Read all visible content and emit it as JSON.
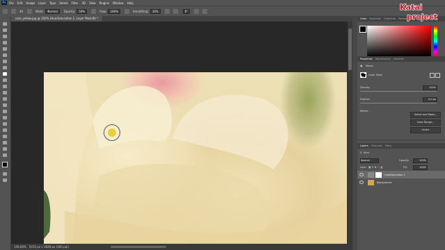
{
  "menubar": {
    "items": [
      "File",
      "Edit",
      "Image",
      "Layer",
      "Type",
      "Select",
      "Filter",
      "3D",
      "View",
      "Plugins",
      "Window",
      "Help"
    ]
  },
  "options": {
    "size": "40",
    "mode_label": "Mode:",
    "mode_value": "Normal",
    "opacity_label": "Opacity:",
    "opacity_value": "50%",
    "flow_label": "Flow:",
    "flow_value": "100%",
    "smoothing_label": "Smoothing:",
    "smoothing_value": "10%",
    "angle_value": "0°"
  },
  "document": {
    "tab_title": "rose_yellow.jpg @ 150% (Hue/Saturation 1, Layer Mask/8) *"
  },
  "status": {
    "zoom": "150.00%",
    "info": "5472 px x 3648 px (300 ppi)"
  },
  "panels": {
    "color_tabs": [
      "Color",
      "Swatches",
      "Gradients",
      "Patterns"
    ],
    "properties_tabs": [
      "Properties",
      "Adjustments",
      "Libraries"
    ],
    "masks_label": "Masks",
    "layer_mask_label": "Layer Mask",
    "density_label": "Density:",
    "density_value": "100%",
    "feather_label": "Feather:",
    "feather_value": "0.0 px",
    "refine_label": "Refine:",
    "select_mask_btn": "Select and Mask...",
    "color_range_btn": "Color Range...",
    "invert_btn": "Invert",
    "layers_tabs": [
      "Layers",
      "Channels",
      "Paths"
    ],
    "kind_label": "Kind",
    "blend_mode": "Normal",
    "opacity_label": "Opacity:",
    "opacity_value": "100%",
    "lock_label": "Lock:",
    "fill_label": "Fill:",
    "fill_value": "100%",
    "layers": [
      {
        "name": "Hue/Saturation 1"
      },
      {
        "name": "Background"
      }
    ]
  },
  "logo": {
    "line1": "Katai",
    "line2": "project"
  }
}
